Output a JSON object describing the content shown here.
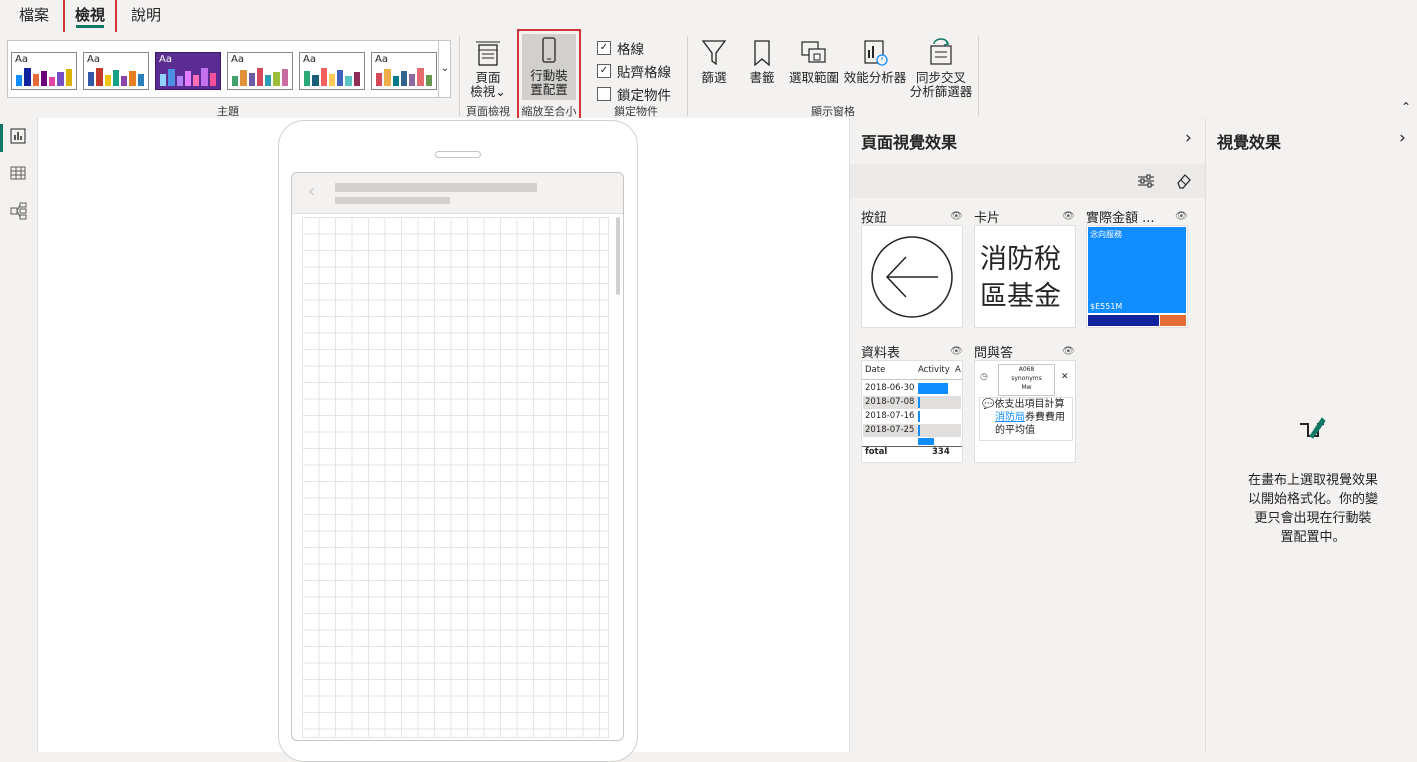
{
  "menu": {
    "file": "檔案",
    "view": "檢視",
    "help": "說明"
  },
  "ribbon": {
    "theme_aa": "Aa",
    "groups": {
      "themes": "主題",
      "page_view": "頁面檢視",
      "scale": "縮放至合小",
      "lock": "鎖定物件",
      "show_panes": "顯示窗格"
    },
    "page_view_btn": [
      "頁面",
      "檢視"
    ],
    "mobile_btn": [
      "行動裝",
      "置配置"
    ],
    "checkboxes": [
      {
        "label": "格線",
        "checked": true
      },
      {
        "label": "貼齊格線",
        "checked": true
      },
      {
        "label": "鎖定物件",
        "checked": false
      }
    ],
    "pane_buttons": {
      "filter": "篩選",
      "bookmark": "書籤",
      "selection": "選取範圍",
      "perf": "效能分析器",
      "sync": [
        "同步交叉",
        "分析篩選器"
      ]
    }
  },
  "pane1": {
    "title": "頁面視覺效果",
    "cards": {
      "button": "按鈕",
      "card": "卡片",
      "actual": "實際金額 ...",
      "table": "資料表",
      "qa": "問與答"
    },
    "card_text": [
      "消防稅",
      "區基金"
    ],
    "treemap": {
      "top": "念向服務",
      "bottom": "$E551M"
    },
    "table_preview": {
      "headers": [
        "Date",
        "Activity",
        "A"
      ],
      "rows": [
        "2018-06-30",
        "2018-07-08",
        "2018-07-16",
        "2018-07-25"
      ],
      "total_label": "fotal",
      "total_value": "334"
    },
    "qa_preview": {
      "logo": [
        "A068",
        "synonyms",
        "Mw"
      ],
      "question": "依支出項目計算",
      "q_link": "消防局",
      "q_rest": "券費費用",
      "q_line3": "的平均值"
    }
  },
  "pane2": {
    "title": "視覺效果",
    "message": [
      "在畫布上選取視覺效果",
      "以開始格式化。你的變",
      "更只會出現在行動裝",
      "置配置中。"
    ]
  },
  "colors": {
    "accent": "#117865",
    "highlight": "#d13438",
    "treemap_blue": "#118dff",
    "treemap_navy": "#12239e",
    "treemap_orange": "#e66c37"
  }
}
